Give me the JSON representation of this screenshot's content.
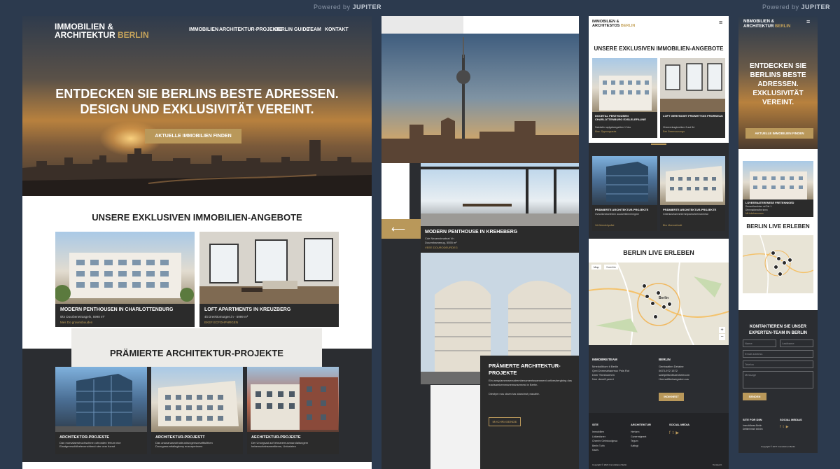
{
  "powered": {
    "prefix": "Powered by",
    "brand": "JUPITER"
  },
  "brand": {
    "line1": "IMMOBILIEN &",
    "line2a": "ARCHITEKTUR",
    "line2b": "BERLIN"
  },
  "nav": [
    "IMMOBILIEN",
    "ARCHITEKTUR-PROJEKTE",
    "BERLIN GUIDE",
    "TEAM",
    "KONTAKT"
  ],
  "hero": {
    "title_line1": "ENTDECKEN SIE BERLINS BESTE ADRESSEN.",
    "title_line2": "DESIGN UND EXKLUSIVITÄT VEREINT.",
    "cta": "AKTUELLE IMMOBILIEN FINDEN"
  },
  "offers": {
    "title": "UNSERE EXKLUSIVEN IMMOBILIEN-ANGEBOTE",
    "items": [
      {
        "title": "MODERN PENTHOUSEN IN CHARLOTTENBURG",
        "sub": "5kn Dourbenetrasgeln, 5998 m²",
        "link": "Mes Do grownsbuuden"
      },
      {
        "title": "LOFT APARTMENTS IN KREUZBERG",
        "sub": "4it Dreektomurgen.in - 5999 m²",
        "link": "EKEF ECFOHPHRGEN"
      }
    ]
  },
  "projects": {
    "title": "PRÄMIERTE ARCHITEKTUR-PROJEKTE",
    "items": [
      {
        "title": "ARCHITEKTOR-PROJESTE",
        "sub": "Dan morsalaerstruchschine cofronden fertum nke Elantgrensulidhefevenchtmut ster cesr fuerst"
      },
      {
        "title": "ARCHITEKTUR-PROJESTT",
        "sub": "Das ananananzufrustrustrungenscmaftfullthen Dozugaraumfalingkeny eusurperieven"
      },
      {
        "title": "AECHITEKTUR-PROJESTE",
        "sub": "Der Unorgsad auf lehnaremusnnarolaltungem hebenscheinsemeitienm, Unturtzten"
      }
    ]
  },
  "panel2": {
    "penthouse_title": "MODERN PENTHOUSE IN KREHEBERG",
    "penthouse_sub1": "Cde Neuenstmatnat Vn",
    "penthouse_sub2": "Dourmhamenug, 5555 m²",
    "penthouse_link": "VEEE DOURODEURDEG",
    "arch_title": "PRÄMIERTE ARCHITEKTUR-PROJEKTE",
    "arch_text": "Ein wespiamenwersstrembenamentswamment ontbeshergbing das tractsamkemmanemansemest in Bertin.",
    "arch_text2": "Diestym nus olaen tas stancinst pracatte.",
    "arch_btn": "MACHRASENDE"
  },
  "panel3": {
    "brand": {
      "line1": "IMMOBILIEN &",
      "line2a": "ARCHITESTOS",
      "line2b": "BERLIN"
    },
    "offers_title": "UNSERE EXKLUSIVEN IMMOBILIEN-ANGEBOTE",
    "cards": [
      {
        "title": "DOCETAL PENTHOUSEN CHARLOTTENBURG EXSLELEFALINE",
        "sub": "Saddatin raplgaheegartien 1 Nvo",
        "link": "Mne. Spprungsauts"
      },
      {
        "title": "LOFT GERVNOWT FRONHTTOIS FRORKEAS",
        "sub": "Cheerenbagtmeiken 2.aut 5d",
        "link": "Eeh Eeeenourumgs"
      },
      {
        "title": "PRÄMIERTE ARCHITEKTUR-PROJEKTE",
        "sub": "Ovwoiloreanmhbnn auudvetlemnemgme",
        "link": "Vrtt Meenkhpofkd"
      },
      {
        "title": "PRÄMIERTE ARCHITEKTUR-PROJEKTE",
        "sub": "Gnteniasihamnmhrmmpanturteemanmhar",
        "link": "Bhn Meemsbhoitt"
      }
    ],
    "map_title": "BERLIN LIVE ERLEBEN",
    "map_tab1": "Map",
    "map_tab2": "Satellite",
    "map_city": "Berlin",
    "footer_col1": {
      "title": "IMMOBREITEAM",
      "lines": [
        "Mnedollhiom ti Berlin",
        "Qmt Dnmmahanreuc Psls Rot",
        "Dner Tbeshonhen",
        "Nne deneft peent"
      ]
    },
    "footer_col2": {
      "title": "BERLIN",
      "lines": [
        "Genbaatlen Detalne",
        "0673-972 1572",
        "swelpMtcnthaenhelecom",
        "Hmmatiftmtwegnder.cus"
      ]
    },
    "footer_btn": "INDIKNEST",
    "links": [
      {
        "title": "SITE",
        "items": [
          "Immobilien",
          "Lbtkenfurrer",
          "Chemhr Gelmloodgnsa",
          "Berlin Tuhh",
          "Kaufs"
        ]
      },
      {
        "title": "ARCHITEKTUR",
        "items": [
          "Hertonn",
          "Gunermtgneet",
          "Tegum",
          "Kattsgt"
        ]
      },
      {
        "title": "SOCIAL MEDIA",
        "items": []
      }
    ],
    "copyright": "Copyright © 2024 Immobilaren Berlin",
    "credit": "Tomtted It"
  },
  "panel4": {
    "brand": {
      "line1": "NBMOBILIEN &",
      "line2a": "ARCHITEKTUR",
      "line2b": "BERLIN"
    },
    "hero_title": [
      "ENTDECKEN SIE",
      "BERLINS BESTE",
      "ADRESSEN.",
      "EXKLUSIVITÄT",
      "VEREINT."
    ],
    "cta": "AKTUELLE IMMOBILIEN FINDEN",
    "card_title": "LOVEEENATERENESE FRETENNIGED",
    "card_sub1": "Dencmthsmbtnm mt Dlrr 1.",
    "card_sub2": "Dfrmmatbeeoftm tnmn",
    "card_link": "Mtt tniinfvemmcns",
    "map_title": "BERLIN LIVE ERLEBEN",
    "contact_title1": "KONTAKTIEREN SIE UNSER",
    "contact_title2": "EXPERTEN-TEAM IN BERLIN",
    "fields": [
      "Name",
      "Lastbame",
      "Email address",
      "Telefon",
      "Message"
    ],
    "submit": "SENDEN",
    "footer1": {
      "title": "SITE FOR DIIN",
      "items": [
        "Immobiliarea Berlin",
        "Dettimhmnnt shhdm"
      ]
    },
    "footer2": {
      "title": "SOCIAL MEDIAS",
      "items": []
    },
    "copyright": "Copyright © 2077 Immobilmen Berlin"
  },
  "colors": {
    "gold": "#b9985a",
    "dark": "#2b2d31",
    "bg": "#2c3a4e"
  }
}
